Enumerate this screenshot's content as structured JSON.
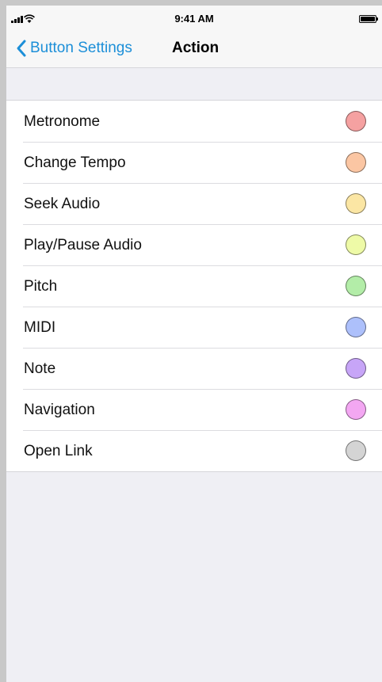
{
  "status_bar": {
    "time": "9:41 AM",
    "icons": [
      "cellular-signal-icon",
      "wifi-icon",
      "battery-icon"
    ]
  },
  "nav": {
    "back_label": "Button Settings",
    "title": "Action"
  },
  "colors": {
    "accent": "#1c8fd8",
    "background": "#efeff4",
    "cell": "#ffffff"
  },
  "actions": [
    {
      "label": "Metronome",
      "color": "#f5a1a1"
    },
    {
      "label": "Change Tempo",
      "color": "#fbc6a3"
    },
    {
      "label": "Seek Audio",
      "color": "#fbe6a4"
    },
    {
      "label": "Play/Pause Audio",
      "color": "#eefaa7"
    },
    {
      "label": "Pitch",
      "color": "#b3eda8"
    },
    {
      "label": "MIDI",
      "color": "#adc0fb"
    },
    {
      "label": "Note",
      "color": "#c7a5f7"
    },
    {
      "label": "Navigation",
      "color": "#f3a7f2"
    },
    {
      "label": "Open Link",
      "color": "#d4d4d4"
    }
  ]
}
